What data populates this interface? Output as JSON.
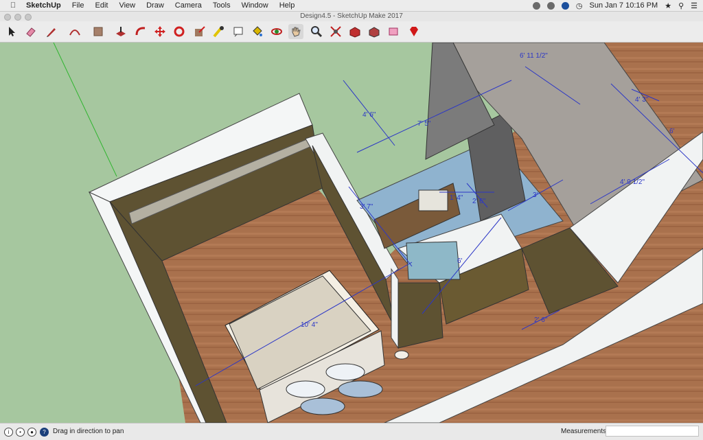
{
  "menubar": {
    "app_name": "SketchUp",
    "items": [
      "File",
      "Edit",
      "View",
      "Draw",
      "Camera",
      "Tools",
      "Window",
      "Help"
    ],
    "clock": "Sun Jan 7  10:16 PM"
  },
  "window": {
    "title": "Design4.5 - SketchUp Make 2017"
  },
  "toolbar": {
    "tools": [
      "select",
      "eraser",
      "pencil",
      "arc",
      "shapes",
      "push-pull",
      "follow-me",
      "move",
      "rotate",
      "scale",
      "tape-measure",
      "text",
      "paint-bucket",
      "orbit",
      "pan",
      "zoom",
      "zoom-extents",
      "3d-warehouse",
      "extension-warehouse",
      "layout",
      "ruby"
    ]
  },
  "dimensions": {
    "d1": "6' 11 1/2\"",
    "d2": "4' 6\"",
    "d3": "7' 5\"",
    "d4": "4' 3\"",
    "d5": "6'",
    "d6": "4' 9 1/2\"",
    "d7": "3' 7\"",
    "d8": "1' 4\"",
    "d9": "2' 6\"",
    "d10": "3'",
    "d11": "6'",
    "d12": "10' 4\"",
    "d13": "2' 6\""
  },
  "status": {
    "hint": "Drag in direction to pan",
    "measurements_label": "Measurements",
    "measurements_value": ""
  },
  "colors": {
    "ground": "#a6c79f",
    "dimension": "#2b36c6",
    "wall_dark": "#5e5232",
    "floor": "#a9714d"
  }
}
